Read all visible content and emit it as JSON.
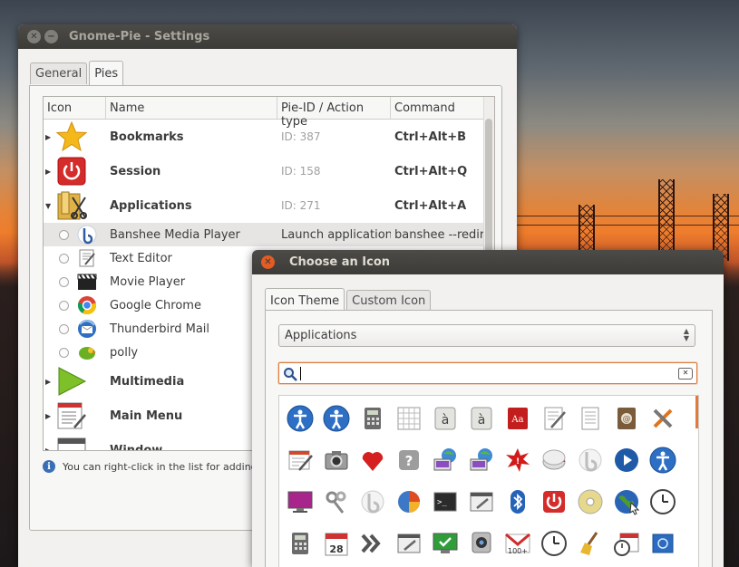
{
  "settings_window": {
    "title": "Gnome-Pie - Settings",
    "tabs": [
      "General",
      "Pies"
    ],
    "columns": [
      "Icon",
      "Name",
      "Pie-ID / Action type",
      "Command"
    ],
    "pies": [
      {
        "name": "Bookmarks",
        "pie_id": "ID: 387",
        "command": "Ctrl+Alt+B",
        "icon": "star-icon",
        "expanded": false
      },
      {
        "name": "Session",
        "pie_id": "ID: 158",
        "command": "Ctrl+Alt+Q",
        "icon": "power-icon",
        "expanded": false
      },
      {
        "name": "Applications",
        "pie_id": "ID: 271",
        "command": "Ctrl+Alt+A",
        "icon": "applications-icon",
        "expanded": true
      }
    ],
    "slices": [
      {
        "name": "Banshee Media Player",
        "action": "Launch application",
        "command": "banshee --redir...",
        "icon": "banshee-icon"
      },
      {
        "name": "Text Editor",
        "icon": "text-editor-icon"
      },
      {
        "name": "Movie Player",
        "icon": "clapperboard-icon"
      },
      {
        "name": "Google Chrome",
        "icon": "chrome-icon"
      },
      {
        "name": "Thunderbird Mail",
        "icon": "thunderbird-icon"
      },
      {
        "name": "polly",
        "icon": "polly-icon"
      }
    ],
    "more_pies": [
      {
        "name": "Multimedia",
        "icon": "play-icon"
      },
      {
        "name": "Main Menu",
        "icon": "menu-icon"
      },
      {
        "name": "Window",
        "icon": "window-icon"
      }
    ],
    "info_text": "You can right-click in the list for adding or r"
  },
  "chooser_dialog": {
    "title": "Choose an Icon",
    "tabs": [
      "Icon Theme",
      "Custom Icon"
    ],
    "category": "Applications",
    "search_value": "",
    "icons": [
      "accessibility-icon",
      "accessibility-icon",
      "calculator-icon",
      "spreadsheet-icon",
      "character-map-icon",
      "character-map-icon",
      "dictionary-icon",
      "text-editor-icon",
      "notes-icon",
      "contacts-book-icon",
      "tools-icon",
      "editor-icon",
      "camera-icon",
      "heart-icon",
      "help-icon",
      "network-display-icon",
      "network-display-icon",
      "burst-icon",
      "disk-usage-icon",
      "banshee-icon",
      "media-play-icon",
      "accessibility-icon",
      "monitor-icon",
      "keys-icon",
      "banshee-icon",
      "pie-chart-icon",
      "terminal-icon",
      "settings-window-icon",
      "bluetooth-icon",
      "power-icon",
      "cd-icon",
      "globe-icon",
      "clock-icon",
      "calculator-icon",
      "calendar-icon",
      "chevrons-icon",
      "settings-window-icon",
      "check-display-icon",
      "webcam-icon",
      "gmail-icon",
      "clock-icon",
      "broom-icon",
      "calendar-clock-icon",
      "flag-icon"
    ]
  }
}
